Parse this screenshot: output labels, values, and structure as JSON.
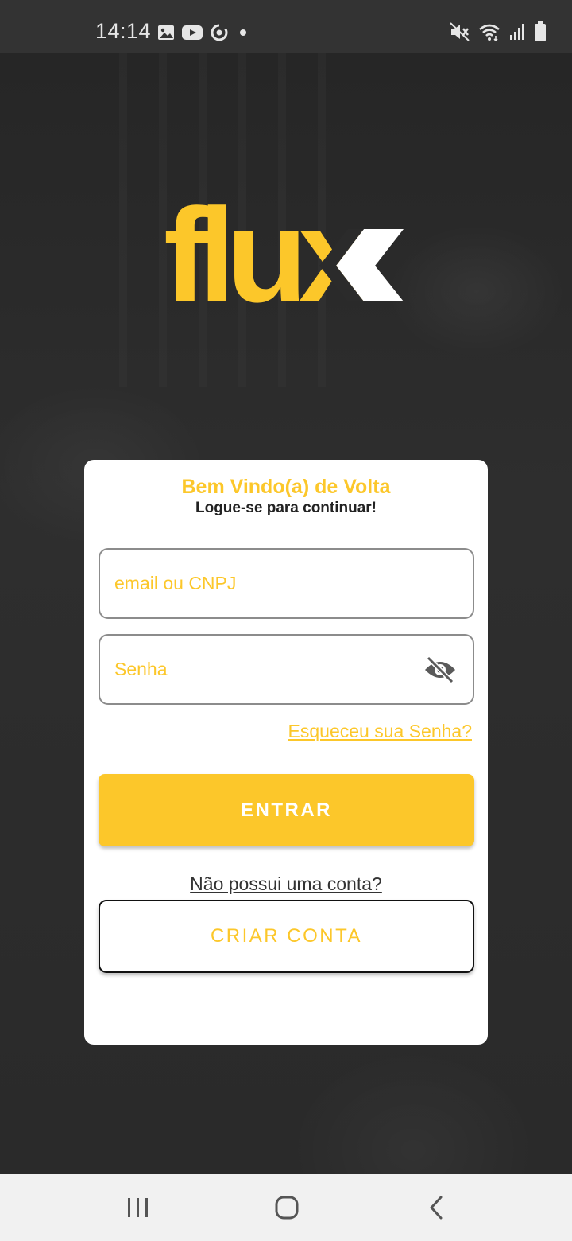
{
  "status_bar": {
    "time": "14:14",
    "left_icons": [
      "image-icon",
      "youtube-icon",
      "sync-icon",
      "dot-icon"
    ],
    "right_icons": [
      "mute-icon",
      "wifi-icon",
      "signal-icon",
      "battery-icon"
    ]
  },
  "logo": {
    "text": "flux",
    "color": "#fcc72a",
    "chevron_color": "#ffffff"
  },
  "card": {
    "title": "Bem Vindo(a) de Volta",
    "subtitle": "Logue-se para continuar!",
    "email_placeholder": "email ou CNPJ",
    "password_placeholder": "Senha",
    "forgot_password": "Esqueceu sua Senha?",
    "login_button": "ENTRAR",
    "no_account": "Não possui uma conta?",
    "create_account_button": "CRIAR CONTA"
  },
  "colors": {
    "accent": "#fcc72a",
    "background": "#2b2b2b",
    "card": "#ffffff",
    "status_bar": "#333333",
    "nav_bar": "#f1f1f1"
  },
  "nav_bar": {
    "buttons": [
      "recent-apps-icon",
      "home-icon",
      "back-icon"
    ]
  }
}
